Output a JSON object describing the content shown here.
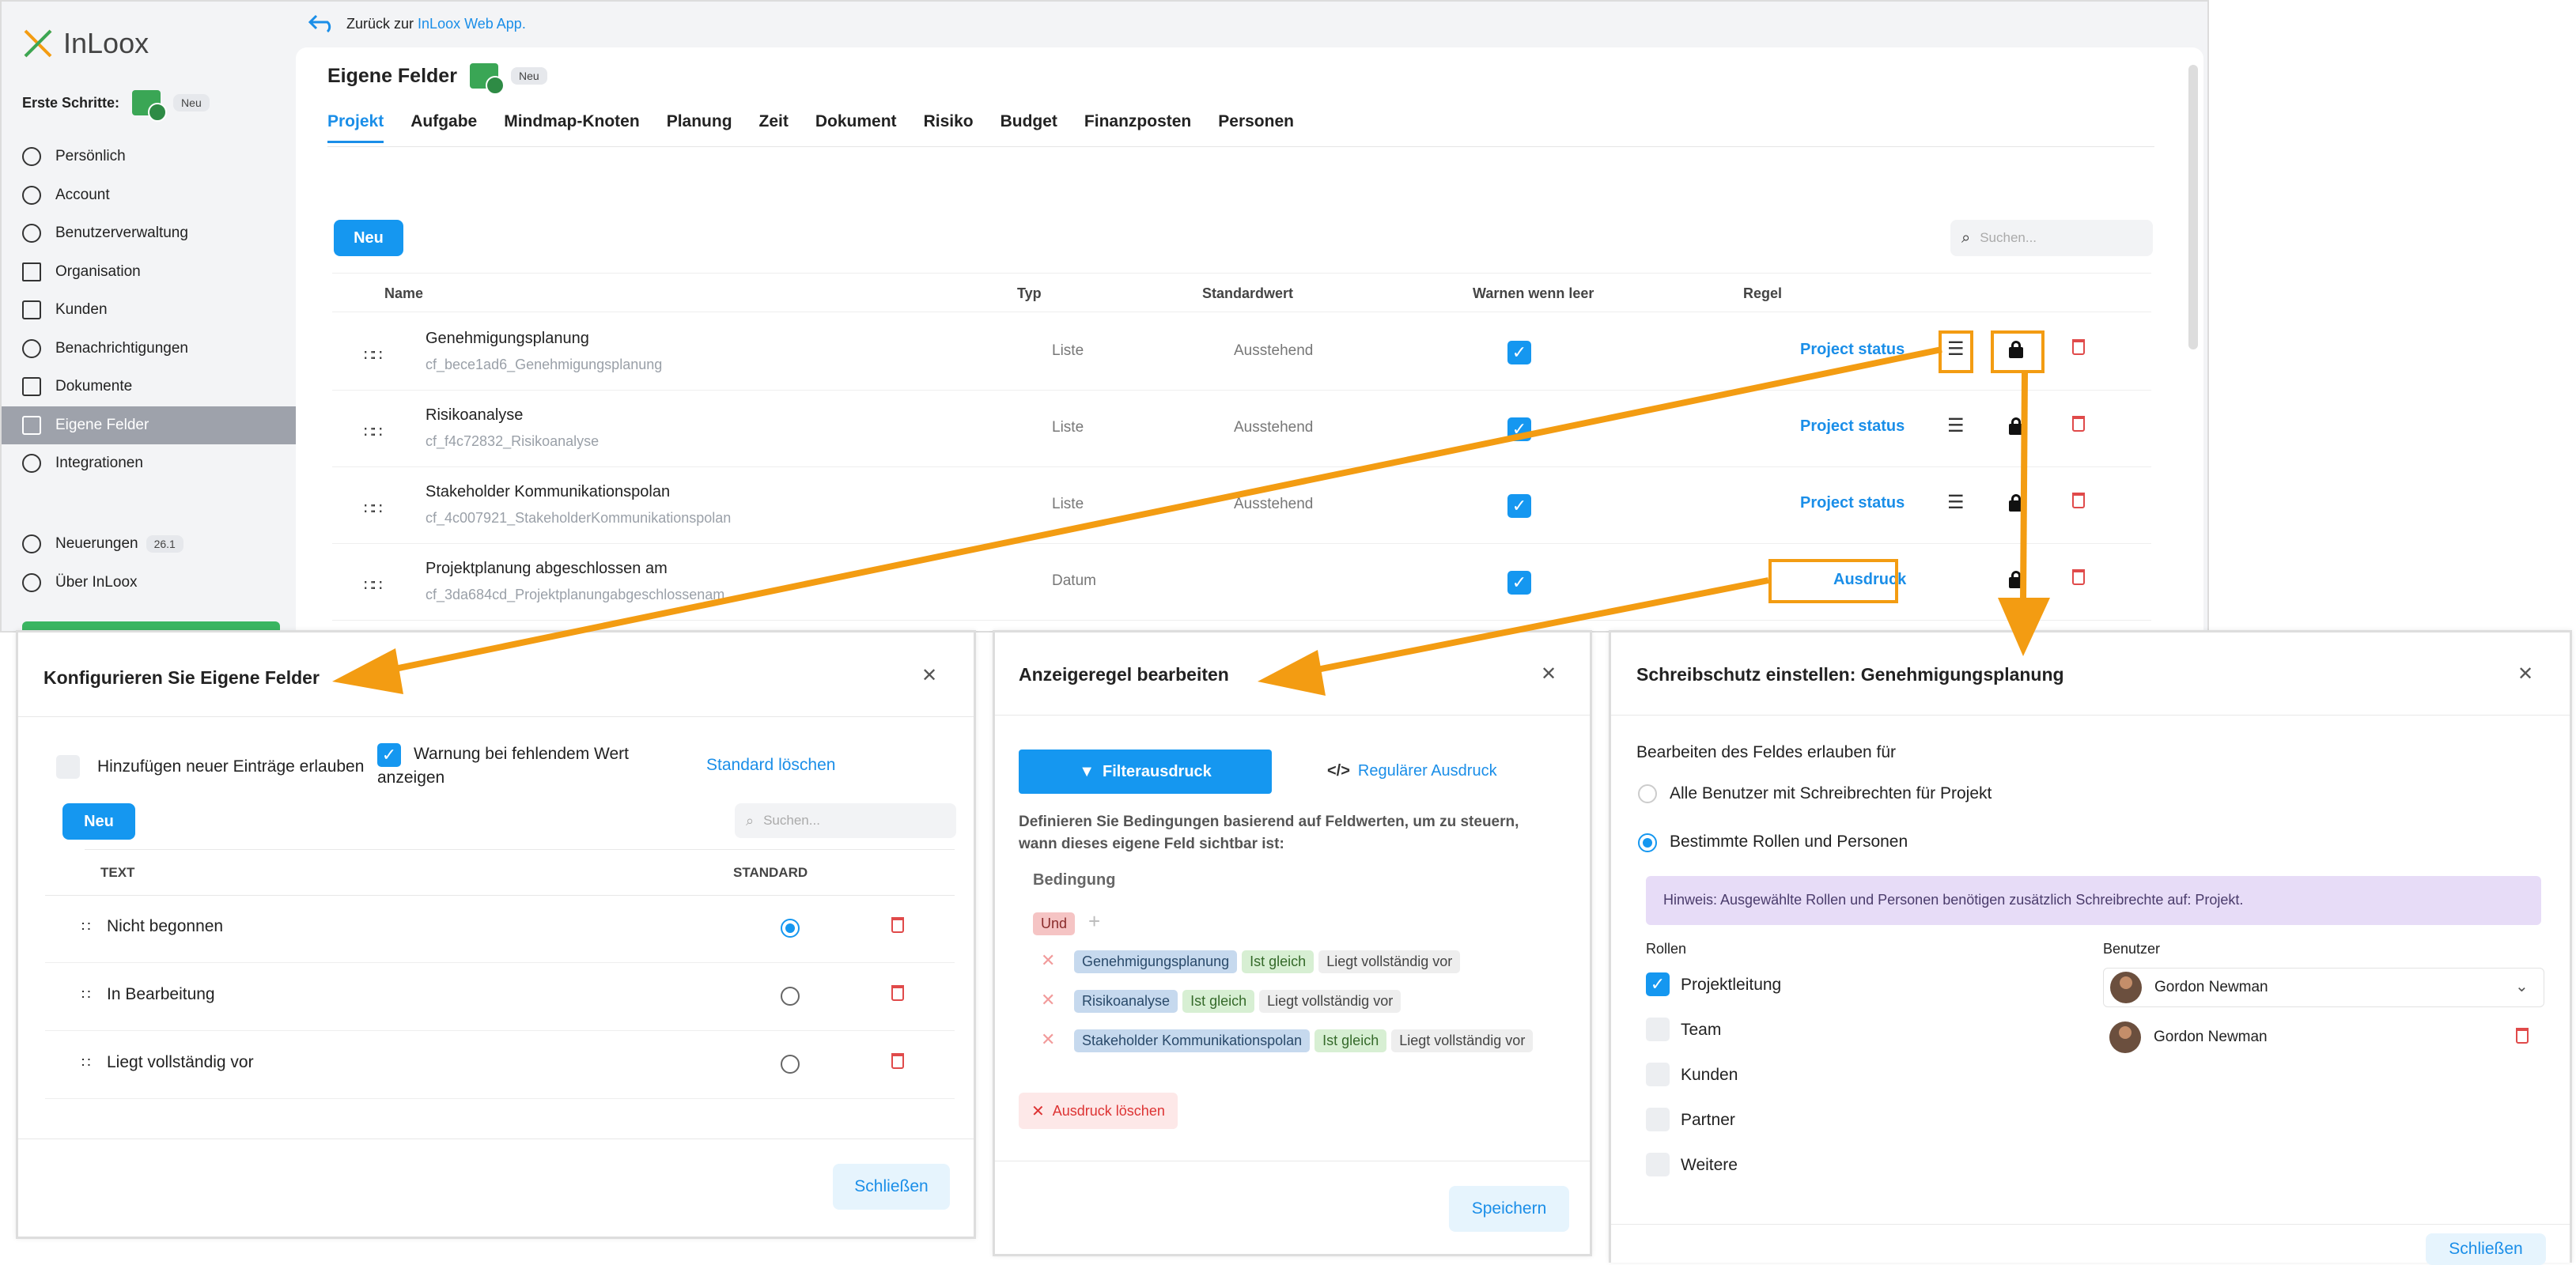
{
  "app": {
    "logo_text": "InLoox",
    "first_steps_label": "Erste Schritte:",
    "first_steps_badge": "Neu",
    "back_text": "Zurück zur",
    "back_link": "InLoox Web App."
  },
  "sidebar": {
    "items": [
      {
        "label": "Persönlich",
        "icon": "user-circle-icon"
      },
      {
        "label": "Account",
        "icon": "globe-icon"
      },
      {
        "label": "Benutzerverwaltung",
        "icon": "users-gear-icon"
      },
      {
        "label": "Organisation",
        "icon": "building-icon"
      },
      {
        "label": "Kunden",
        "icon": "contact-card-icon"
      },
      {
        "label": "Benachrichtigungen",
        "icon": "bell-icon"
      },
      {
        "label": "Dokumente",
        "icon": "document-check-icon"
      },
      {
        "label": "Eigene Felder",
        "icon": "custom-fields-icon"
      },
      {
        "label": "Integrationen",
        "icon": "integrations-icon"
      }
    ],
    "secondary": [
      {
        "label": "Neuerungen",
        "badge": "26.1",
        "icon": "sparkle-icon"
      },
      {
        "label": "Über InLoox",
        "icon": "bulb-icon"
      }
    ]
  },
  "page": {
    "title": "Eigene Felder",
    "title_badge": "Neu",
    "tabs": [
      "Projekt",
      "Aufgabe",
      "Mindmap-Knoten",
      "Planung",
      "Zeit",
      "Dokument",
      "Risiko",
      "Budget",
      "Finanzposten",
      "Personen"
    ],
    "new_button": "Neu",
    "search_placeholder": "Suchen...",
    "columns": [
      "Name",
      "Typ",
      "Standardwert",
      "Warnen wenn leer",
      "Regel"
    ],
    "rows": [
      {
        "name": "Genehmigungsplanung",
        "id": "cf_bece1ad6_Genehmigungsplanung",
        "type": "Liste",
        "default": "Ausstehend",
        "warn": true,
        "rule": "Project status"
      },
      {
        "name": "Risikoanalyse",
        "id": "cf_f4c72832_Risikoanalyse",
        "type": "Liste",
        "default": "Ausstehend",
        "warn": true,
        "rule": "Project status"
      },
      {
        "name": "Stakeholder Kommunikationspolan",
        "id": "cf_4c007921_StakeholderKommunikationspolan",
        "type": "Liste",
        "default": "Ausstehend",
        "warn": true,
        "rule": "Project status"
      },
      {
        "name": "Projektplanung abgeschlossen am",
        "id": "cf_3da684cd_Projektplanungabgeschlossenam",
        "type": "Datum",
        "default": "",
        "warn": true,
        "rule": "Ausdruck"
      }
    ]
  },
  "dialog_configure": {
    "title": "Konfigurieren Sie Eigene Felder",
    "allow_new_label": "Hinzufügen neuer Einträge erlauben",
    "warn_label_1": "Warnung bei fehlendem Wert",
    "warn_label_2": "anzeigen",
    "clear_default": "Standard löschen",
    "new_button": "Neu",
    "search_placeholder": "Suchen...",
    "col_text": "TEXT",
    "col_standard": "STANDARD",
    "items": [
      "Nicht begonnen",
      "In Bearbeitung",
      "Liegt vollständig vor"
    ],
    "close_button": "Schließen"
  },
  "dialog_rule": {
    "title": "Anzeigeregel bearbeiten",
    "tab_filter": "Filterausdruck",
    "tab_regex": "Regulärer Ausdruck",
    "description": "Definieren Sie Bedingungen basierend auf Feldwerten, um zu steuern, wann dieses eigene Feld sichtbar ist:",
    "condition_label": "Bedingung",
    "and_tag": "Und",
    "conditions": [
      {
        "field": "Genehmigungsplanung",
        "op": "Ist gleich",
        "value": "Liegt vollständig vor"
      },
      {
        "field": "Risikoanalyse",
        "op": "Ist gleich",
        "value": "Liegt vollständig vor"
      },
      {
        "field": "Stakeholder Kommunikationspolan",
        "op": "Ist gleich",
        "value": "Liegt vollständig vor"
      }
    ],
    "clear_expression": "Ausdruck löschen",
    "save_button": "Speichern"
  },
  "dialog_protect": {
    "title": "Schreibschutz einstellen: Genehmigungsplanung",
    "allow_edit_label": "Bearbeiten des Feldes erlauben für",
    "option_all": "Alle Benutzer mit Schreibrechten für Projekt",
    "option_specific": "Bestimmte Rollen und Personen",
    "hint": "Hinweis: Ausgewählte Rollen und Personen benötigen zusätzlich Schreibrechte auf: Projekt.",
    "roles_header": "Rollen",
    "users_header": "Benutzer",
    "roles": [
      {
        "label": "Projektleitung",
        "checked": true
      },
      {
        "label": "Team",
        "checked": false
      },
      {
        "label": "Kunden",
        "checked": false
      },
      {
        "label": "Partner",
        "checked": false
      },
      {
        "label": "Weitere",
        "checked": false
      }
    ],
    "user_select": "Gordon Newman",
    "user_entry": "Gordon Newman",
    "close_button": "Schließen"
  },
  "colors": {
    "accent": "#1597f0",
    "annotation": "#f39c12",
    "danger": "#e04040",
    "active_nav": "#9ea2ab"
  }
}
